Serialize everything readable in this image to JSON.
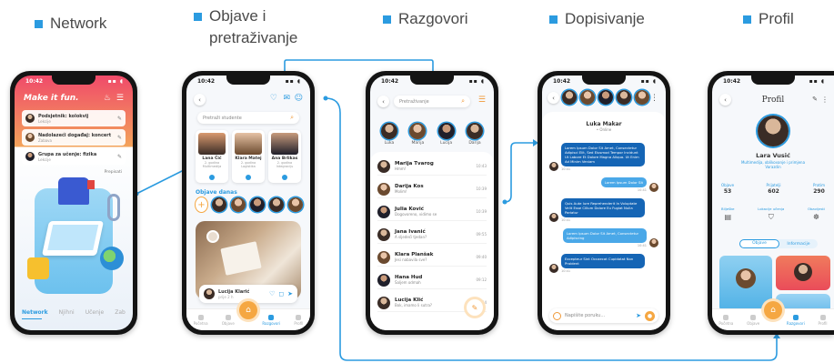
{
  "labels": {
    "network": "Network",
    "posts": "Objave i\npretraživanje",
    "chats": "Razgovori",
    "messaging": "Dopisivanje",
    "profile": "Profil"
  },
  "accent": "#2b9be0",
  "phone1": {
    "time": "10:42",
    "brand": "Make it fun.",
    "items": [
      {
        "title": "Podsjetnik: kolokvij",
        "sub": "Lekcije"
      },
      {
        "title": "Nadolazeći događaj: koncert",
        "sub": "Zabava"
      },
      {
        "title": "Grupa za učenje: fizika",
        "sub": "Lekcije"
      }
    ],
    "more": "Prepisati",
    "tabs": [
      "Network",
      "Njihni",
      "Učenje",
      "Zab"
    ]
  },
  "phone2": {
    "time": "10:42",
    "search_placeholder": "Pretraži studente",
    "cards": [
      {
        "name": "Lana Čić",
        "sub": "2. godina\nMultimedija"
      },
      {
        "name": "Klara Matej",
        "sub": "2. godina\nLogistika"
      },
      {
        "name": "Ana Brlikas",
        "sub": "2. godina\nIntegraciju"
      }
    ],
    "section": "Objave danas",
    "post_author": "Lucija Klarić",
    "post_time": "prije 2 h",
    "nav": [
      "Početna",
      "Objave",
      "",
      "Razgovori",
      "Profil"
    ]
  },
  "phone3": {
    "time": "10:42",
    "search_placeholder": "Pretraživanje",
    "top": [
      "Luka",
      "Marija",
      "Lucija",
      "Darija"
    ],
    "chats": [
      {
        "name": "Marija Tvarog",
        "msg": "Hmm!",
        "time": "10:43"
      },
      {
        "name": "Darija Kos",
        "msg": "Molim!",
        "time": "10:39"
      },
      {
        "name": "Julia Ković",
        "msg": "Dogovoreno, vidimo se",
        "time": "10:39"
      },
      {
        "name": "Jana Ivanić",
        "msg": "A sljedeći tjedan?",
        "time": "09:55"
      },
      {
        "name": "Klara Planšak",
        "msg": "Jesi nabavila sve?",
        "time": "09:40"
      },
      {
        "name": "Hana Hud",
        "msg": "Šaljem odmah",
        "time": "09:12"
      },
      {
        "name": "Lucija Klić",
        "msg": "Bok, imamo li sutra?",
        "time": "08:44"
      }
    ]
  },
  "phone4": {
    "time": "10:42",
    "contact": "Luka Makar",
    "status": "• Online",
    "messages": [
      {
        "side": "left",
        "text": "Lorem Ipsum Dolor Sit Amet, Consectetur Adipisci Elit, Sed Eiusmod Tempor Incidunt Ut Labore Et Dolore Magna Aliqua. Ut Enim Ad Minim Veniam",
        "time": "10:41"
      },
      {
        "side": "right",
        "text": "Lorem Ipsum Dolor Sit",
        "time": "10:41"
      },
      {
        "side": "left",
        "text": "Quis Aute Iure Reprehenderit In Voluptate Velit Esse Cillum Dolore Eu Fugiat Nulla Pariatur",
        "time": "10:41"
      },
      {
        "side": "right",
        "text": "Lorem Ipsum Dolor Sit Amet, Consectetur Adipiscing",
        "time": "10:41"
      },
      {
        "side": "left",
        "text": "Excepteur Sint Occaecat Cupidatat Non Proident",
        "time": "10:41"
      }
    ],
    "input_placeholder": "Napišite poruku..."
  },
  "phone5": {
    "time": "10:42",
    "title": "Profil",
    "name": "Lara Vusić",
    "bio": "Multimedija, oblikovanje i primjena\nVarazdin",
    "stats": [
      {
        "label": "Objave",
        "value": "53"
      },
      {
        "label": "Prijatelji",
        "value": "602"
      },
      {
        "label": "Pratim",
        "value": "290"
      }
    ],
    "links": [
      "Bilješke",
      "Lokacije učenja",
      "Obavijesti"
    ],
    "tabs": [
      "Objave",
      "Informacije"
    ],
    "nav": [
      "Početna",
      "Objave",
      "",
      "Razgovori",
      "Profil"
    ]
  }
}
